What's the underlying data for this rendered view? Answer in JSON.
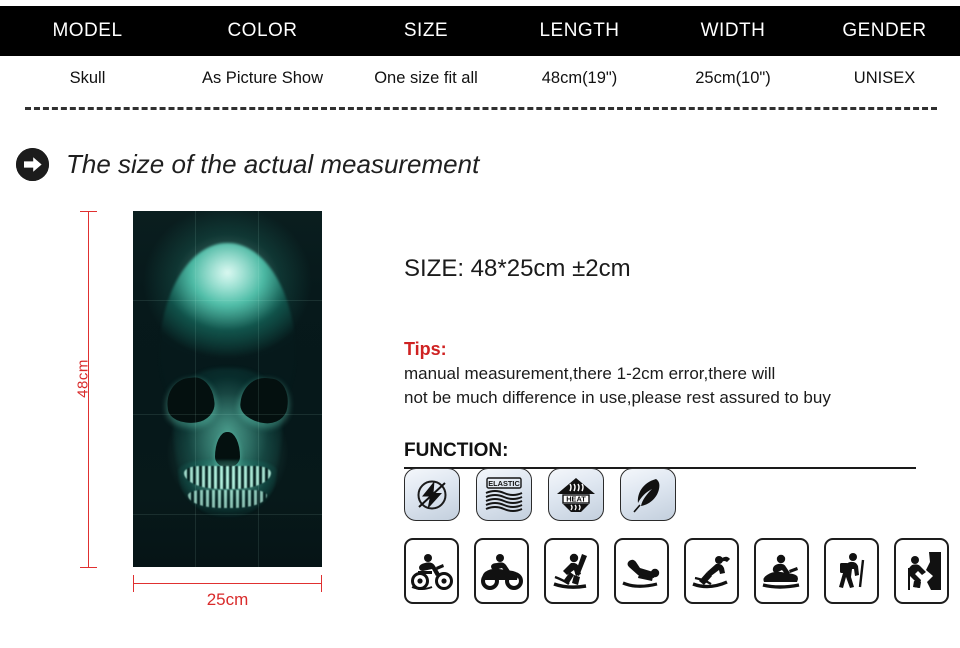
{
  "spec_table": {
    "headers": [
      "MODEL",
      "COLOR",
      "SIZE",
      "LENGTH",
      "WIDTH",
      "GENDER"
    ],
    "values": [
      "Skull",
      "As Picture Show",
      "One size fit all",
      "48cm(19\")",
      "25cm(10\")",
      "UNISEX"
    ]
  },
  "section": {
    "arrow_icon": "arrow-right-circle-icon",
    "title": "The size of the actual measurement"
  },
  "product": {
    "image_alt": "teal skull print neck gaiter tube scarf",
    "dimensions": {
      "height_label": "48cm",
      "width_label": "25cm"
    }
  },
  "info": {
    "size_line": "SIZE: 48*25cm  ±2cm",
    "tips_heading": "Tips:",
    "tips_lines": [
      "manual measurement,there 1-2cm error,there will",
      "not be much difference in use,please rest assured to buy"
    ],
    "function_heading": "FUNCTION:"
  },
  "features": [
    {
      "name": "anti-static-icon",
      "label": ""
    },
    {
      "name": "elastic-icon",
      "label": "ELASTIC"
    },
    {
      "name": "heat-retention-icon",
      "label": "HEAT"
    },
    {
      "name": "lightweight-feather-icon",
      "label": ""
    }
  ],
  "activities": [
    {
      "name": "motorcycle-icon"
    },
    {
      "name": "atv-quad-bike-icon"
    },
    {
      "name": "skiing-icon"
    },
    {
      "name": "sledding-icon"
    },
    {
      "name": "water-skiing-icon"
    },
    {
      "name": "snowmobile-icon"
    },
    {
      "name": "hiking-icon"
    },
    {
      "name": "rock-climbing-icon"
    }
  ],
  "colors": {
    "header_bar": "#000000",
    "accent_red": "#d92b2b",
    "tips_red": "#cf2222",
    "text_dark": "#1a1a1a",
    "product_teal": "#2ecfae"
  }
}
